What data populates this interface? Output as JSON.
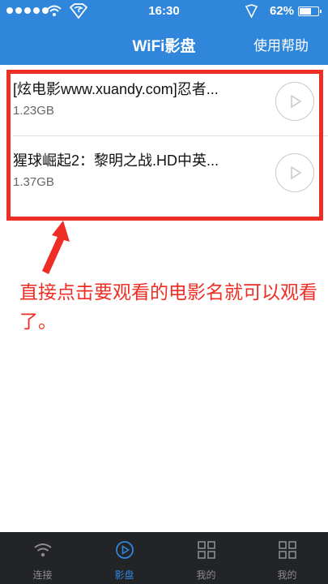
{
  "status_bar": {
    "time": "16:30",
    "battery": "62%"
  },
  "nav": {
    "title": "WiFi影盘",
    "help": "使用帮助"
  },
  "files": [
    {
      "name": "[炫电影www.xuandy.com]忍者...",
      "size": "1.23GB"
    },
    {
      "name": "猩球崛起2：黎明之战.HD中英...",
      "size": "1.37GB"
    }
  ],
  "annotation": "直接点击要观看的电影名就可以观看了。",
  "tabs": [
    {
      "label": "连接",
      "icon": "wifi-icon"
    },
    {
      "label": "影盘",
      "icon": "play-circle-icon"
    },
    {
      "label": "我的",
      "icon": "grid-icon"
    },
    {
      "label": "我的",
      "icon": "grid-icon"
    }
  ],
  "colors": {
    "accent": "#2f86db",
    "annotation_red": "#ee2e24",
    "tabbar": "#222428"
  }
}
